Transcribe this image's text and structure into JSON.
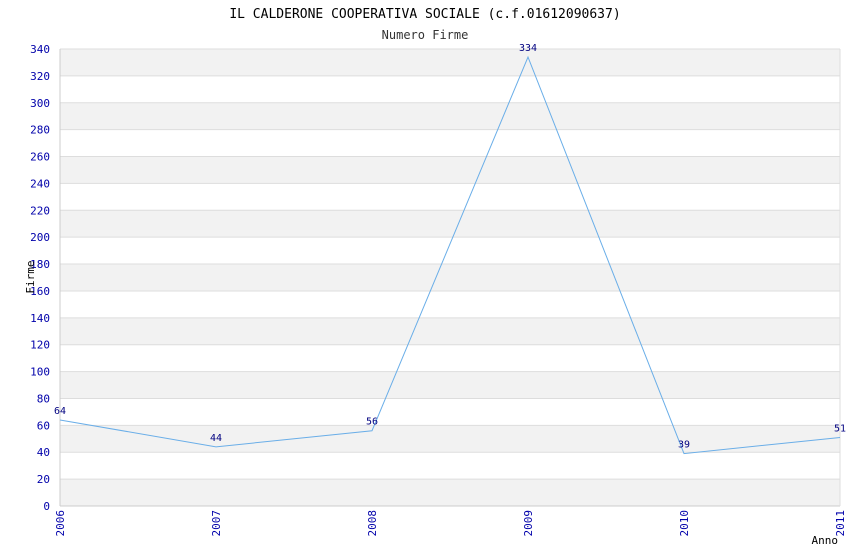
{
  "chart_data": {
    "type": "line",
    "title": "IL CALDERONE COOPERATIVA SOCIALE (c.f.01612090637)",
    "subtitle": "Numero Firme",
    "xlabel": "Anno",
    "ylabel": "Firme",
    "x": [
      "2006",
      "2007",
      "2008",
      "2009",
      "2010",
      "2011"
    ],
    "values": [
      64,
      44,
      56,
      334,
      39,
      51
    ],
    "ylim": [
      0,
      340
    ],
    "ytick_step": 20,
    "grid": true,
    "colors": {
      "line": "#6aaee8",
      "band": "#f2f2f2",
      "gridline": "#dddddd",
      "tick_text": "#0000aa",
      "data_label": "#000080"
    }
  }
}
